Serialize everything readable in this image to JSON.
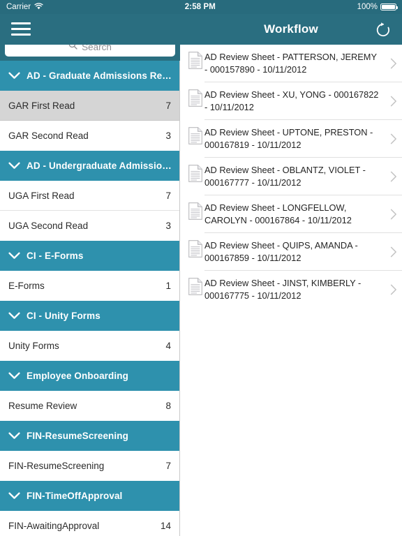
{
  "status_bar": {
    "carrier": "Carrier",
    "wifi_icon": "wifi-icon",
    "time": "2:58 PM",
    "battery_percent": "100%",
    "battery_icon": "battery-full-icon"
  },
  "nav_bar": {
    "menu_icon": "hamburger-menu-icon",
    "title": "Workflow",
    "refresh_icon": "refresh-icon"
  },
  "search": {
    "placeholder": "Search",
    "value": "",
    "icon": "search-icon"
  },
  "sidebar": {
    "chevron_icon": "chevron-down-icon",
    "sections": [
      {
        "title": "AD - Graduate Admissions Review",
        "expanded": true,
        "queues": [
          {
            "label": "GAR First Read",
            "count": "7",
            "selected": true
          },
          {
            "label": "GAR Second Read",
            "count": "3",
            "selected": false
          }
        ]
      },
      {
        "title": "AD - Undergraduate Admissions Re…",
        "expanded": true,
        "queues": [
          {
            "label": "UGA First Read",
            "count": "7",
            "selected": false
          },
          {
            "label": "UGA Second Read",
            "count": "3",
            "selected": false
          }
        ]
      },
      {
        "title": "CI - E-Forms",
        "expanded": true,
        "queues": [
          {
            "label": "E-Forms",
            "count": "1",
            "selected": false
          }
        ]
      },
      {
        "title": "CI - Unity Forms",
        "expanded": true,
        "queues": [
          {
            "label": "Unity Forms",
            "count": "4",
            "selected": false
          }
        ]
      },
      {
        "title": "Employee Onboarding",
        "expanded": true,
        "queues": [
          {
            "label": "Resume Review",
            "count": "8",
            "selected": false
          }
        ]
      },
      {
        "title": "FIN-ResumeScreening",
        "expanded": true,
        "queues": [
          {
            "label": "FIN-ResumeScreening",
            "count": "7",
            "selected": false
          }
        ]
      },
      {
        "title": "FIN-TimeOffApproval",
        "expanded": true,
        "queues": [
          {
            "label": "FIN-AwaitingApproval",
            "count": "14",
            "selected": false
          }
        ]
      }
    ]
  },
  "document_list": {
    "row_icon": "document-icon",
    "disclosure_icon": "chevron-right-icon",
    "items": [
      {
        "title": " AD Review Sheet - PATTERSON, JEREMY - 000157890 - 10/11/2012"
      },
      {
        "title": " AD Review Sheet - XU, YONG - 000167822 - 10/11/2012"
      },
      {
        "title": " AD Review Sheet - UPTONE, PRESTON - 000167819 - 10/11/2012"
      },
      {
        "title": " AD Review Sheet - OBLANTZ, VIOLET - 000167777 - 10/11/2012"
      },
      {
        "title": " AD Review Sheet - LONGFELLOW, CAROLYN - 000167864 - 10/11/2012"
      },
      {
        "title": " AD Review Sheet - QUIPS, AMANDA - 000167859 - 10/11/2012"
      },
      {
        "title": " AD Review Sheet - JINST, KIMBERLY - 000167775 - 10/11/2012"
      }
    ]
  },
  "colors": {
    "status_bar_bg": "#286b7d",
    "nav_bar_bg": "#2a6e80",
    "section_header_bg": "#2e91ad",
    "selected_row_bg": "#d5d5d5",
    "panel_bg": "#ffffff",
    "text_primary": "#242424",
    "placeholder": "#8e8e93",
    "divider": "#e0e0e0"
  }
}
